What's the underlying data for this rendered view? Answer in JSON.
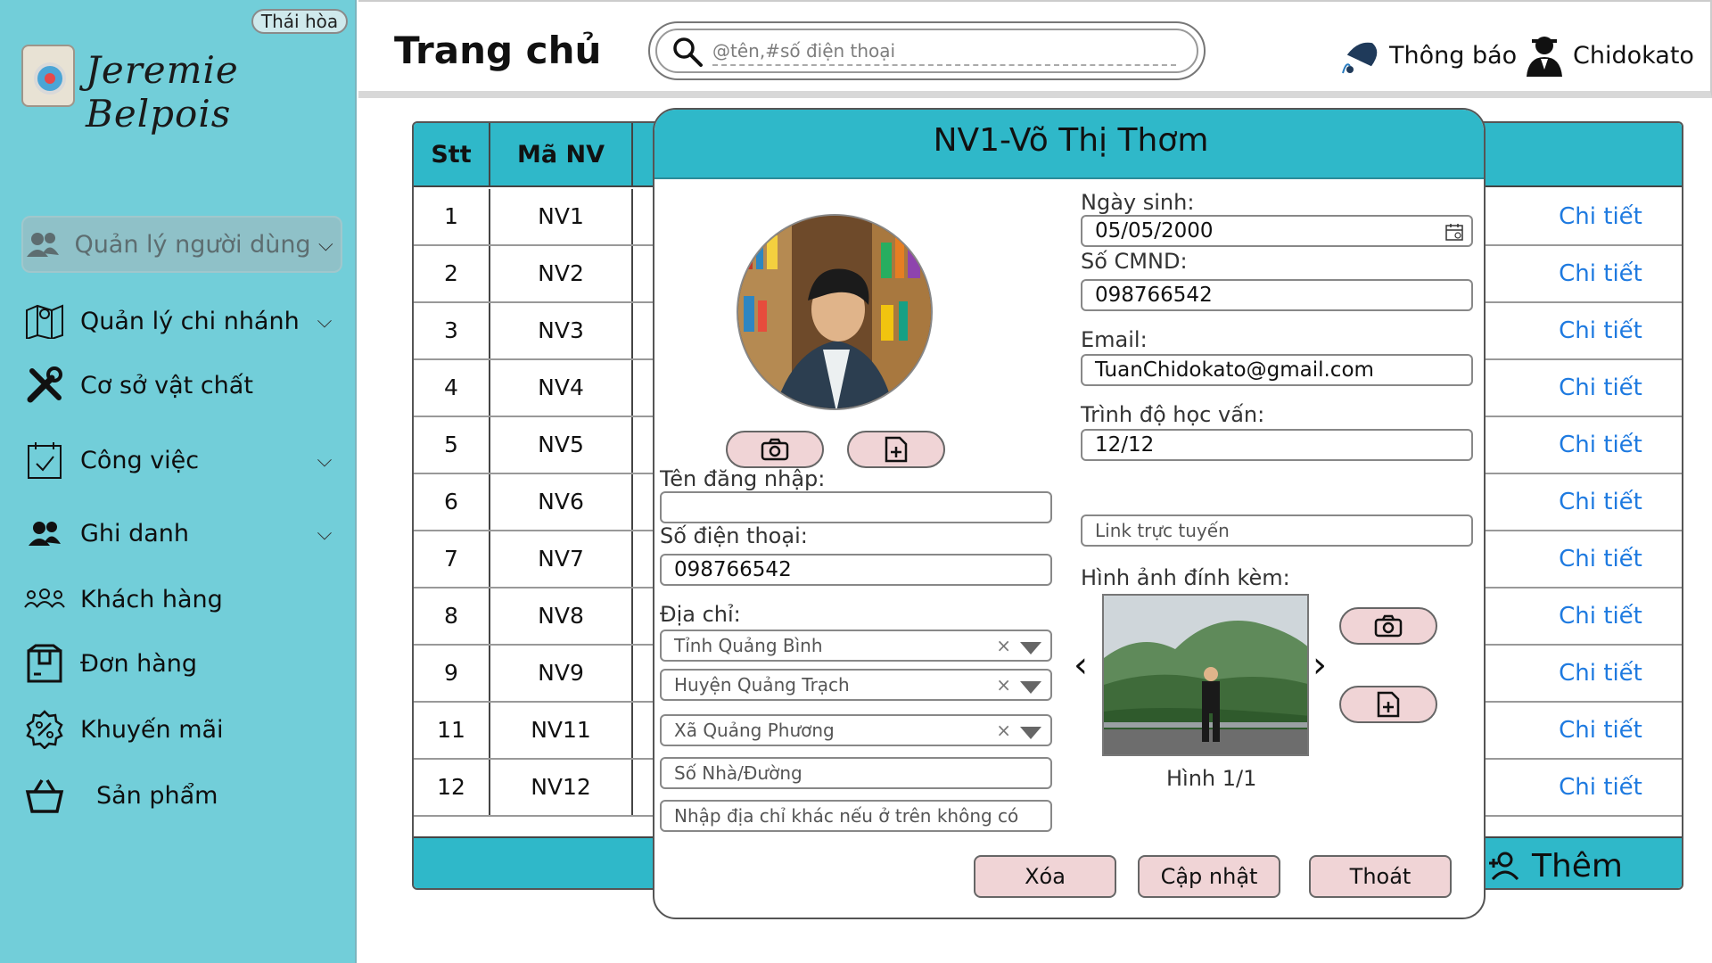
{
  "sidebar": {
    "branch": "Thái hòa",
    "logo_text": "Jeremie Belpois",
    "menu": [
      {
        "label": "Quản lý người dùng",
        "icon": "users-icon",
        "has_submenu": true,
        "active": true
      },
      {
        "label": "Quản lý chi nhánh",
        "icon": "map-icon",
        "has_submenu": true,
        "active": false
      },
      {
        "label": "Cơ sở vật chất",
        "icon": "tools-icon",
        "has_submenu": false,
        "active": false
      },
      {
        "label": "Công việc",
        "icon": "calendar-check-icon",
        "has_submenu": true,
        "active": false
      },
      {
        "label": "Ghi danh",
        "icon": "group-icon",
        "has_submenu": true,
        "active": false
      },
      {
        "label": "Khách hàng",
        "icon": "customers-icon",
        "has_submenu": false,
        "active": false
      },
      {
        "label": "Đơn hàng",
        "icon": "package-icon",
        "has_submenu": false,
        "active": false
      },
      {
        "label": "Khuyến mãi",
        "icon": "discount-icon",
        "has_submenu": false,
        "active": false
      },
      {
        "label": "Sản phẩm",
        "icon": "basket-icon",
        "has_submenu": false,
        "active": false
      }
    ]
  },
  "header": {
    "title": "Trang chủ",
    "search_placeholder": "@tên,#số điện thoại",
    "notification_label": "Thông báo",
    "user_name": "Chidokato"
  },
  "table": {
    "columns": [
      "Stt",
      "Mã NV"
    ],
    "detail_label": "Chi tiết",
    "rows": [
      {
        "stt": "1",
        "code": "NV1"
      },
      {
        "stt": "2",
        "code": "NV2"
      },
      {
        "stt": "3",
        "code": "NV3"
      },
      {
        "stt": "4",
        "code": "NV4"
      },
      {
        "stt": "5",
        "code": "NV5"
      },
      {
        "stt": "6",
        "code": "NV6"
      },
      {
        "stt": "7",
        "code": "NV7"
      },
      {
        "stt": "8",
        "code": "NV8"
      },
      {
        "stt": "9",
        "code": "NV9"
      },
      {
        "stt": "11",
        "code": "NV11"
      },
      {
        "stt": "12",
        "code": "NV12"
      }
    ],
    "add_label": "Thêm"
  },
  "modal": {
    "title": "NV1-Võ Thị Thơm",
    "username_label": "Tên đăng nhập:",
    "username_value": "",
    "phone_label": "Số điện thoại:",
    "phone_value": "098766542",
    "address_label": "Địa chỉ:",
    "province": "Tỉnh Quảng Bình",
    "district": "Huyện Quảng Trạch",
    "ward": "Xã Quảng Phương",
    "street_placeholder": "Số Nhà/Đường",
    "other_address_placeholder": "Nhập địa chỉ khác nếu ở trên không có",
    "birth_label": "Ngày sinh:",
    "birth_value": "05/05/2000",
    "id_label": "Số CMND:",
    "id_value": "098766542",
    "email_label": "Email:",
    "email_value": "TuanChidokato@gmail.com",
    "education_label": "Trình độ học vấn:",
    "education_value": "12/12",
    "link_placeholder": "Link trực tuyến",
    "attachment_label": "Hình ảnh đính kèm:",
    "image_counter": "Hình 1/1",
    "delete_label": "Xóa",
    "update_label": "Cập nhật",
    "exit_label": "Thoát"
  },
  "colors": {
    "sidebar_bg": "#72ced9",
    "accent": "#2fb8c9",
    "button_bg": "#f0d4d6",
    "link": "#1e7ae0"
  }
}
